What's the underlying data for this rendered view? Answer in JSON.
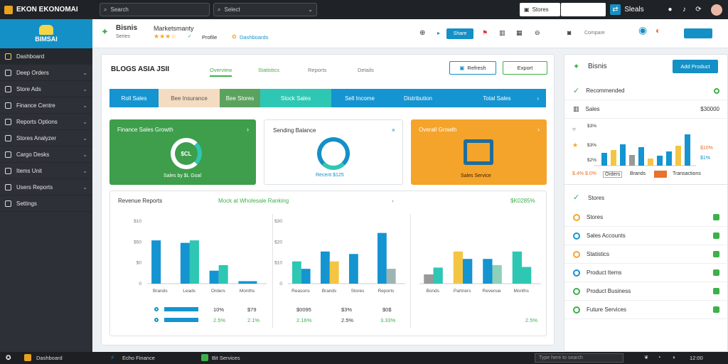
{
  "window": {
    "title": "EKON EKONOMAI"
  },
  "topbar": {
    "search_placeholder": "Search the dashboard",
    "search_value": "Search",
    "select_value": "Select",
    "account_label": "Stores",
    "account_input": "",
    "user_label": "Sleals"
  },
  "sidebar": {
    "brand": "BIMSAI",
    "items": [
      {
        "label": "Dashboard",
        "active": true
      },
      {
        "label": "Deep Orders"
      },
      {
        "label": "Store Ads"
      },
      {
        "label": "Finance Centre"
      },
      {
        "label": "Reports Options"
      },
      {
        "label": "Stores Analyzer"
      },
      {
        "label": "Cargo Desks"
      },
      {
        "label": "Items Unit"
      },
      {
        "label": "Users Reports"
      },
      {
        "label": "Settings"
      }
    ]
  },
  "header": {
    "title": "Bisnis",
    "subtitle": "Marketsmanty",
    "rating_label": "Series",
    "tag_a": "Profile",
    "tag_b": "Dashboards",
    "button_primary": "Share",
    "compare_label": "Compare"
  },
  "main": {
    "title": "BLOGS ASIA JSII",
    "tabs": [
      "Overview",
      "Statistics",
      "Reports",
      "Details"
    ],
    "btn_new": "Refresh",
    "btn_export": "Export",
    "segments": [
      "Roll Sales",
      "Bee Insurance",
      "Bee Stores",
      "Stock Sales",
      "Sell Income",
      "Distribution",
      "Total Sales"
    ],
    "cards": {
      "green": {
        "title": "Finance Sales Growth",
        "center": "$CL",
        "caption": "Sales by $L Goal"
      },
      "white": {
        "title": "Sending Balance",
        "caption": "Recent $125"
      },
      "orange": {
        "title": "Overall Growth",
        "caption": "Sales Service"
      }
    },
    "panel": {
      "title": "Revenue Reports",
      "subtitle": "Mock at Wholesale Ranking",
      "amount": "$K0285%",
      "chart_a": {
        "yticks": [
          "$10",
          "$50",
          "$0",
          "0"
        ],
        "xlabels": [
          "Brands",
          "Leads",
          "Orders",
          "Months"
        ]
      },
      "chart_b": {
        "yticks": [
          "$30",
          "$20",
          "$10",
          "0"
        ],
        "xlabels": [
          "Reasons",
          "Brands",
          "Stores",
          "Reports"
        ]
      },
      "chart_c": {
        "xlabels": [
          "Bonds",
          "Partners",
          "Revenue",
          "Months"
        ]
      },
      "stats_row1": [
        "10%",
        "$79",
        "$0095",
        "$3%",
        "$0$"
      ],
      "stats_row2": [
        "2.5%",
        "2.1%",
        "2.16%",
        "2.5%",
        "3.33%",
        "2.5%"
      ]
    }
  },
  "right_panel": {
    "title": "Bisnis",
    "button": "Add Product",
    "row_check": "Recommended",
    "row_label": "Sales",
    "row_value": "$30000",
    "ticks": [
      "$3%",
      "$3%",
      "$2%"
    ],
    "chart_values": [
      "$10%",
      "$1%"
    ],
    "side_a": "$.4%",
    "side_b": "$.0%",
    "legend": [
      "Orders",
      "Brands",
      "Transactions"
    ],
    "section2": "Stores",
    "list": [
      {
        "label": "Stores",
        "color": "#f3a632"
      },
      {
        "label": "Sales Accounts",
        "color": "#1494d0"
      },
      {
        "label": "Statistics",
        "color": "#f3a632"
      },
      {
        "label": "Product Items",
        "color": "#1494d0"
      },
      {
        "label": "Product Business",
        "color": "#3db04a"
      },
      {
        "label": "Future Services",
        "color": "#3db04a"
      }
    ]
  },
  "taskbar": {
    "item1": "Dashboard",
    "item2": "Echo Finance",
    "item3": "Bit Services",
    "search": "Type here to search",
    "time": "12:00"
  },
  "chart_data": [
    {
      "type": "bar",
      "categories": [
        "Brands",
        "Leads",
        "Orders",
        "Months"
      ],
      "series": [
        {
          "values": [
            70,
            66,
            21,
            4
          ]
        },
        {
          "values": [
            0,
            70,
            30,
            4
          ]
        }
      ]
    },
    {
      "type": "bar",
      "categories": [
        "Reasons",
        "Brands",
        "Stores",
        "Reports"
      ],
      "series": [
        {
          "values": [
            36,
            52,
            48,
            82
          ]
        },
        {
          "values": [
            24,
            36,
            0,
            24
          ]
        }
      ]
    },
    {
      "type": "bar",
      "categories": [
        "Bonds",
        "Partners",
        "Revenue",
        "Months"
      ],
      "series": [
        {
          "values": [
            15,
            52,
            40,
            52
          ]
        },
        {
          "values": [
            26,
            40,
            30,
            27
          ]
        }
      ]
    }
  ]
}
